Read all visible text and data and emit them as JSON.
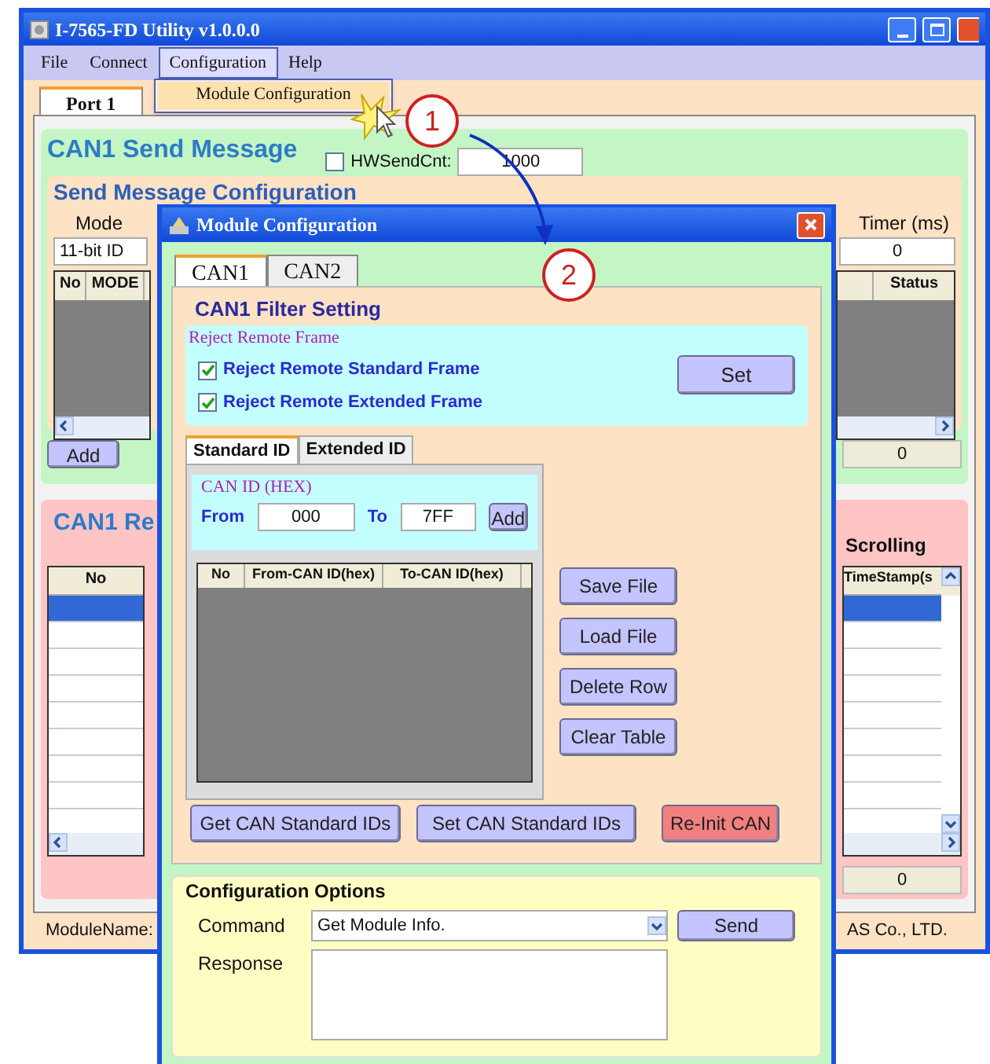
{
  "main_window": {
    "title": "I-7565-FD Utility v1.0.0.0",
    "menu": [
      {
        "label": "File",
        "selected": false
      },
      {
        "label": "Connect",
        "selected": false
      },
      {
        "label": "Configuration",
        "selected": true
      },
      {
        "label": "Help",
        "selected": false
      }
    ],
    "open_menu": {
      "items": [
        "Module Configuration"
      ]
    },
    "port_tabs": [
      {
        "label": "Port 1",
        "selected": true
      }
    ],
    "send_panel": {
      "title": "CAN1 Send Message",
      "hw_send_cnt": {
        "label": "HWSendCnt:",
        "checked": false,
        "value": "1000"
      },
      "config_title": "Send Message Configuration",
      "mode_label": "Mode",
      "mode_value": "11-bit ID",
      "timer_label": "Timer (ms)",
      "timer_value": "0",
      "columns_left": [
        "No",
        "MODE"
      ],
      "columns_right": [
        "Status"
      ],
      "add_button": "Add",
      "count": "0"
    },
    "receive_panel": {
      "title": "CAN1 Re",
      "scrolling_label": "Scrolling",
      "column_left": "No",
      "column_right": "TimeStamp(s",
      "rows": [
        {
          "selected": true
        },
        {
          "selected": false
        },
        {
          "selected": false
        },
        {
          "selected": false
        },
        {
          "selected": false
        },
        {
          "selected": false
        },
        {
          "selected": false
        },
        {
          "selected": false
        }
      ],
      "count": "0"
    },
    "status_bar": {
      "left": "ModuleName:",
      "right": "AS Co., LTD."
    }
  },
  "dialog": {
    "title": "Module Configuration",
    "tabs": [
      {
        "label": "CAN1",
        "selected": true
      },
      {
        "label": "CAN2",
        "selected": false
      }
    ],
    "filter": {
      "title": "CAN1 Filter Setting",
      "reject_group": "Reject Remote Frame",
      "options": [
        {
          "label": "Reject Remote Standard Frame",
          "checked": true
        },
        {
          "label": "Reject Remote Extended Frame",
          "checked": true
        }
      ],
      "set_button": "Set",
      "id_tabs": [
        {
          "label": "Standard ID",
          "selected": true
        },
        {
          "label": "Extended ID",
          "selected": false
        }
      ],
      "can_id": {
        "title": "CAN ID (HEX)",
        "from_label": "From",
        "from_value": "000",
        "to_label": "To",
        "to_value": "7FF",
        "add_button": "Add"
      },
      "table": {
        "columns": [
          "No",
          "From-CAN ID(hex)",
          "To-CAN ID(hex)"
        ]
      },
      "side_buttons": [
        "Save File",
        "Load File",
        "Delete Row",
        "Clear Table"
      ],
      "bottom_buttons": [
        {
          "label": "Get CAN Standard IDs",
          "kind": "normal"
        },
        {
          "label": "Set CAN Standard IDs",
          "kind": "normal"
        },
        {
          "label": "Re-Init CAN",
          "kind": "warning"
        }
      ]
    },
    "config_options": {
      "title": "Configuration Options",
      "command_label": "Command",
      "command_value": "Get Module Info.",
      "send_button": "Send",
      "response_label": "Response"
    }
  },
  "annotations": [
    {
      "label": "1"
    },
    {
      "label": "2"
    }
  ]
}
